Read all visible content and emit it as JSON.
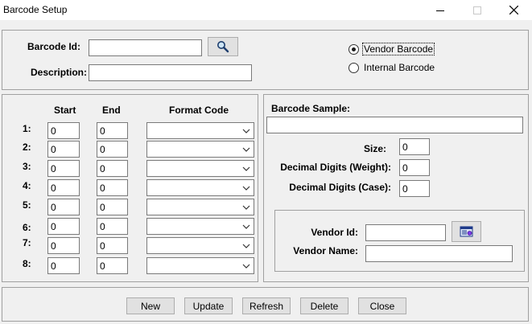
{
  "window": {
    "title": "Barcode Setup"
  },
  "top": {
    "barcode_id_label": "Barcode Id:",
    "barcode_id_value": "",
    "description_label": "Description:",
    "description_value": "",
    "radio_vendor": "Vendor Barcode",
    "radio_internal": "Internal Barcode",
    "selected_radio": "vendor"
  },
  "format": {
    "col_start": "Start",
    "col_end": "End",
    "col_format": "Format Code",
    "rows": [
      {
        "label": "1:",
        "start": "0",
        "end": "0",
        "format": ""
      },
      {
        "label": "2:",
        "start": "0",
        "end": "0",
        "format": ""
      },
      {
        "label": "3:",
        "start": "0",
        "end": "0",
        "format": ""
      },
      {
        "label": "4:",
        "start": "0",
        "end": "0",
        "format": ""
      },
      {
        "label": "5:",
        "start": "0",
        "end": "0",
        "format": ""
      },
      {
        "label": "6:",
        "start": "0",
        "end": "0",
        "format": ""
      },
      {
        "label": "7:",
        "start": "0",
        "end": "0",
        "format": ""
      },
      {
        "label": "8:",
        "start": "0",
        "end": "0",
        "format": ""
      }
    ]
  },
  "sample": {
    "barcode_sample_label": "Barcode Sample:",
    "barcode_sample_value": "",
    "size_label": "Size:",
    "size_value": "0",
    "dec_weight_label": "Decimal Digits (Weight):",
    "dec_weight_value": "0",
    "dec_case_label": "Decimal Digits (Case):",
    "dec_case_value": "0",
    "vendor_id_label": "Vendor Id:",
    "vendor_id_value": "",
    "vendor_name_label": "Vendor Name:",
    "vendor_name_value": ""
  },
  "buttons": {
    "new": "New",
    "update": "Update",
    "refresh": "Refresh",
    "delete": "Delete",
    "close": "Close"
  }
}
